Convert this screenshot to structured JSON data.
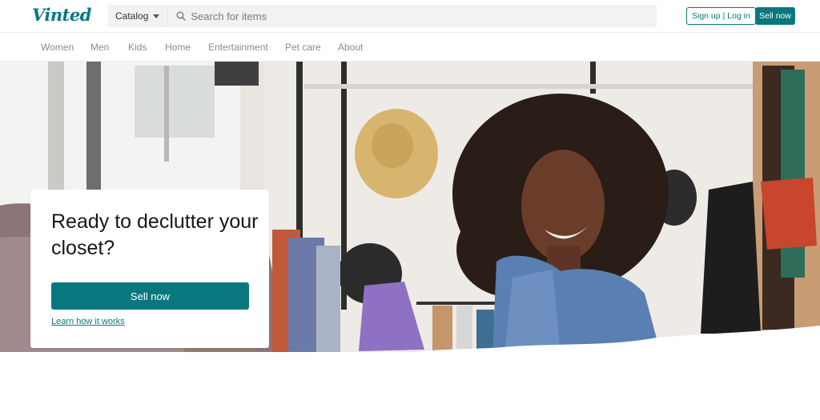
{
  "header": {
    "logo": "Vinted",
    "catalog_label": "Catalog",
    "search_placeholder": "Search for items",
    "signup_login_label": "Sign up | Log in",
    "sell_now_label": "Sell now"
  },
  "nav": {
    "items": [
      "Women",
      "Men",
      "Kids",
      "Home",
      "Entertainment",
      "Pet care",
      "About"
    ]
  },
  "hero": {
    "title": "Ready to declutter your closet?",
    "cta_label": "Sell now",
    "link_label": "Learn how it works"
  },
  "colors": {
    "brand": "#09787e",
    "nav_text": "#8a8a8a",
    "page_background": "#ffffff"
  },
  "icons": {
    "search": "search-icon",
    "catalog_dropdown": "caret-down-icon"
  }
}
